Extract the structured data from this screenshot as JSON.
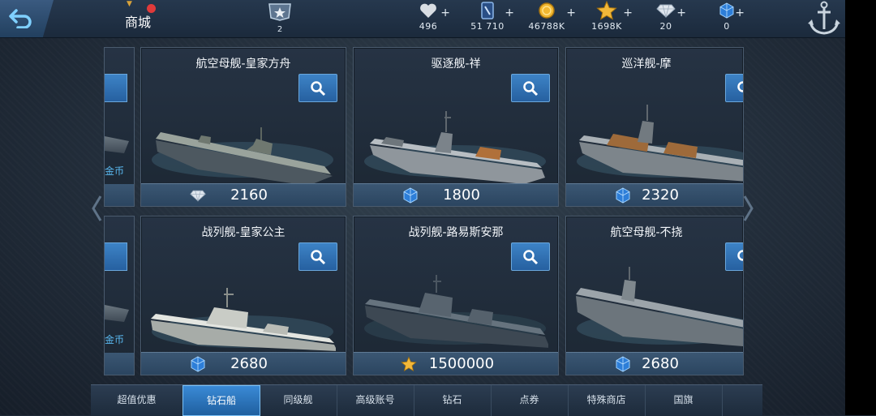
{
  "header": {
    "title": "商城",
    "rank_value": "2",
    "resources": [
      {
        "icon": "heart-icon",
        "value": "496"
      },
      {
        "icon": "card-icon",
        "value": "51 710"
      },
      {
        "icon": "gold-coin-icon",
        "value": "46788K"
      },
      {
        "icon": "star-icon",
        "value": "1698K"
      },
      {
        "icon": "diamond-icon",
        "value": "20"
      },
      {
        "icon": "blue-gem-icon",
        "value": "0"
      }
    ]
  },
  "partial_cards": [
    {
      "price_label": "金币"
    },
    {
      "price_label": "金币"
    }
  ],
  "cards": [
    {
      "name": "航空母舰-皇家方舟",
      "currency": "diamond",
      "price": "2160"
    },
    {
      "name": "驱逐舰-祥",
      "currency": "blue-gem",
      "price": "1800"
    },
    {
      "name": "巡洋舰-摩",
      "currency": "blue-gem",
      "price": "2320"
    },
    {
      "name": "战列舰-皇家公主",
      "currency": "blue-gem",
      "price": "2680"
    },
    {
      "name": "战列舰-路易斯安那",
      "currency": "star",
      "price": "1500000"
    },
    {
      "name": "航空母舰-不挠",
      "currency": "blue-gem",
      "price": "2680"
    }
  ],
  "tabs": [
    {
      "label": "超值优惠",
      "active": false
    },
    {
      "label": "钻石船",
      "active": true
    },
    {
      "label": "同级舰",
      "active": false
    },
    {
      "label": "高级账号",
      "active": false
    },
    {
      "label": "钻石",
      "active": false
    },
    {
      "label": "点券",
      "active": false
    },
    {
      "label": "特殊商店",
      "active": false
    },
    {
      "label": "国旗",
      "active": false
    }
  ],
  "colors": {
    "accent": "#2f7cc4",
    "badge": "#e03a3a",
    "gold": "#f1b730"
  }
}
